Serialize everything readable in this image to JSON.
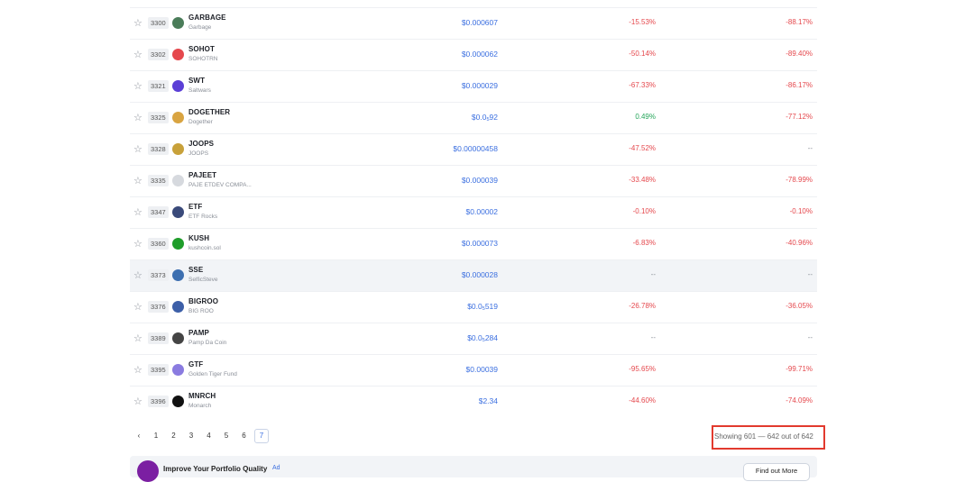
{
  "table": {
    "rows": [
      {
        "rank": "3300",
        "symbol": "GARBAGE",
        "name": "Garbage",
        "price": "$0.000607",
        "ch1": "-15.53%",
        "ch1_class": "neg",
        "ch2": "-88.17%",
        "ch2_class": "neg",
        "icon": "garbage-coin-icon",
        "color": "#4a7c59"
      },
      {
        "rank": "3302",
        "symbol": "SOHOT",
        "name": "SOHOTRN",
        "price": "$0.000062",
        "ch1": "-50.14%",
        "ch1_class": "neg",
        "ch2": "-89.40%",
        "ch2_class": "neg",
        "icon": "flame-icon",
        "color": "#e5484d"
      },
      {
        "rank": "3321",
        "symbol": "SWT",
        "name": "Saltwars",
        "price": "$0.000029",
        "ch1": "-67.33%",
        "ch1_class": "neg",
        "ch2": "-86.17%",
        "ch2_class": "neg",
        "icon": "swt-coin-icon",
        "color": "#5b3fd6"
      },
      {
        "rank": "3325",
        "symbol": "DOGETHER",
        "name": "Dogether",
        "price_main": "$0.0",
        "price_sub": "5",
        "price_tail": "92",
        "ch1": "0.49%",
        "ch1_class": "pos",
        "ch2": "-77.12%",
        "ch2_class": "neg",
        "icon": "doge-coin-icon",
        "color": "#d9a441"
      },
      {
        "rank": "3328",
        "symbol": "JOOPS",
        "name": "JOOPS",
        "price": "$0.00000458",
        "ch1": "-47.52%",
        "ch1_class": "neg",
        "ch2": "--",
        "ch2_class": "dash",
        "icon": "joops-coin-icon",
        "color": "#c8a13a"
      },
      {
        "rank": "3335",
        "symbol": "PAJEET",
        "name": "PAJE ETDEV COMPA...",
        "price": "$0.000039",
        "ch1": "-33.48%",
        "ch1_class": "neg",
        "ch2": "-78.99%",
        "ch2_class": "neg",
        "icon": "pajeet-coin-icon",
        "color": "#d6d9de"
      },
      {
        "rank": "3347",
        "symbol": "ETF",
        "name": "ETF Rocks",
        "price": "$0.00002",
        "ch1": "-0.10%",
        "ch1_class": "neg",
        "ch2": "-0.10%",
        "ch2_class": "neg",
        "icon": "rocket-icon",
        "color": "#3a4a7a"
      },
      {
        "rank": "3360",
        "symbol": "KUSH",
        "name": "kushcoin.sol",
        "price": "$0.000073",
        "ch1": "-6.83%",
        "ch1_class": "neg",
        "ch2": "-40.96%",
        "ch2_class": "neg",
        "icon": "kush-coin-icon",
        "color": "#1f9d2a"
      },
      {
        "rank": "3373",
        "symbol": "SSE",
        "name": "SelficSteve",
        "price": "$0.000028",
        "ch1": "--",
        "ch1_class": "dash",
        "ch2": "--",
        "ch2_class": "dash",
        "icon": "sse-coin-icon",
        "color": "#3d6fb0",
        "hover": true
      },
      {
        "rank": "3376",
        "symbol": "BIGROO",
        "name": "BIG ROO",
        "price_main": "$0.0",
        "price_sub": "5",
        "price_tail": "519",
        "ch1": "-26.78%",
        "ch1_class": "neg",
        "ch2": "-36.05%",
        "ch2_class": "neg",
        "icon": "bigroo-coin-icon",
        "color": "#3d5fa8"
      },
      {
        "rank": "3389",
        "symbol": "PAMP",
        "name": "Pamp Da Coin",
        "price_main": "$0.0",
        "price_sub": "5",
        "price_tail": "284",
        "ch1": "--",
        "ch1_class": "dash",
        "ch2": "--",
        "ch2_class": "dash",
        "icon": "pamp-coin-icon",
        "color": "#444444"
      },
      {
        "rank": "3395",
        "symbol": "GTF",
        "name": "Golden Tiger Fund",
        "price": "$0.00039",
        "ch1": "-95.65%",
        "ch1_class": "neg",
        "ch2": "-99.71%",
        "ch2_class": "neg",
        "icon": "gtf-coin-icon",
        "color": "#8a7be0"
      },
      {
        "rank": "3396",
        "symbol": "MNRCH",
        "name": "Monarch",
        "price": "$2.34",
        "ch1": "-44.60%",
        "ch1_class": "neg",
        "ch2": "-74.09%",
        "ch2_class": "neg",
        "icon": "monarch-coin-icon",
        "color": "#111111"
      }
    ]
  },
  "pagination": {
    "prev_icon": "chevron-left-icon",
    "pages": [
      "1",
      "2",
      "3",
      "4",
      "5",
      "6",
      "7"
    ],
    "active": "7",
    "showing": "Showing 601 — 642 out of 642"
  },
  "ad": {
    "title": "Improve Your Portfolio Quality",
    "tag": "Ad",
    "button": "Find out More"
  }
}
